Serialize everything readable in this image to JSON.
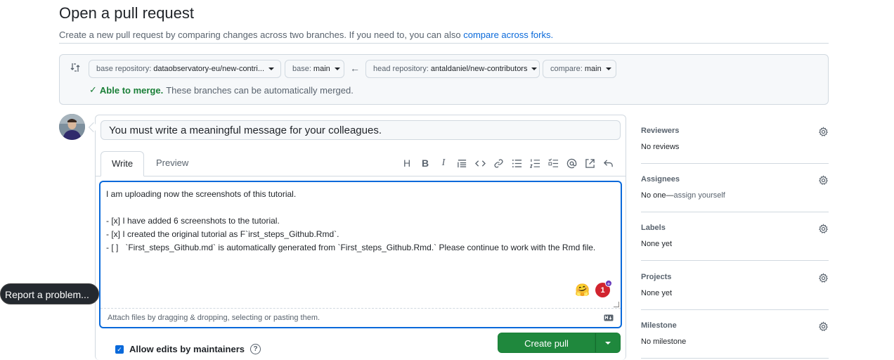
{
  "header": {
    "title": "Open a pull request",
    "subtitle": "Create a new pull request by comparing changes across two branches. If you need to, you can also",
    "subtitle_link": "compare across forks."
  },
  "range": {
    "base_repo_label": "base repository:",
    "base_repo_value": "dataobservatory-eu/new-contri...",
    "base_label": "base:",
    "base_value": "main",
    "head_repo_label": "head repository:",
    "head_repo_value": "antaldaniel/new-contributors",
    "compare_label": "compare:",
    "compare_value": "main",
    "merge_status_bold": "Able to merge.",
    "merge_status_text": "These branches can be automatically merged."
  },
  "composer": {
    "title_value": "You must write a meaningful message for your colleagues.",
    "tabs": [
      {
        "label": "Write"
      },
      {
        "label": "Preview"
      }
    ],
    "body": "I am uploading now the screenshots of this tutorial.\n\n- [x] I have added 6 screenshots to the tutorial.\n- [x] I created the original tutorial as F`irst_steps_Github.Rmd`.\n- [ ]   `First_steps_Github.md` is automatically generated from `First_steps_Github.Rmd.` Please continue to work with the Rmd file.",
    "attach_text": "Attach files by dragging & dropping, selecting or pasting them.",
    "badge_count": "1",
    "allow_edits_label": "Allow edits by maintainers",
    "create_button": "Create pull request"
  },
  "tooltip": {
    "label": "Report a problem..."
  },
  "sidebar": {
    "sections": [
      {
        "title": "Reviewers",
        "value": "No reviews"
      },
      {
        "title": "Assignees",
        "value": "No one—",
        "value_link": "assign yourself"
      },
      {
        "title": "Labels",
        "value": "None yet"
      },
      {
        "title": "Projects",
        "value": "None yet"
      },
      {
        "title": "Milestone",
        "value": "No milestone"
      }
    ]
  },
  "colors": {
    "accent": "#0969da",
    "success": "#1f883d",
    "danger": "#d1242f"
  }
}
